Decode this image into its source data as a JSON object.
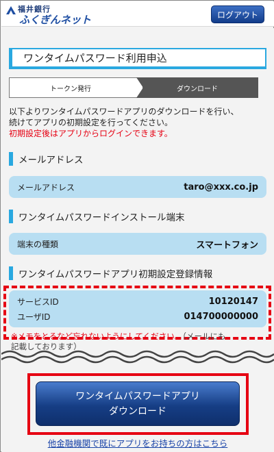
{
  "header": {
    "bank_name": "福井銀行",
    "service_name": "ふくぎんネット",
    "logout_label": "ログアウト"
  },
  "page_title": "ワンタイムパスワード利用申込",
  "steps": [
    {
      "label": "トークン発行",
      "active": false
    },
    {
      "label": "ダウンロード",
      "active": true
    }
  ],
  "intro": {
    "line1": "以下よりワンタイムパスワードアプリのダウンロードを行い、",
    "line2": "続けてアプリの初期設定を行ってください。",
    "warning": "初期設定後はアプリからログインできます。"
  },
  "sections": {
    "email": {
      "title": "メールアドレス",
      "label": "メールアドレス",
      "value": "taro@xxx.co.jp"
    },
    "device": {
      "title": "ワンタイムパスワードインストール端末",
      "label": "端末の種類",
      "value": "スマートフォン"
    },
    "registration": {
      "title": "ワンタイムパスワードアプリ初期設定登録情報",
      "service_id_label": "サービスID",
      "service_id_value": "10120147",
      "user_id_label": "ユーザID",
      "user_id_value": "014700000000"
    }
  },
  "note": {
    "red": "※メモをとるなど忘れないようにしてください。",
    "gray_line1": "（メールにも",
    "gray_line2": "記載しております）"
  },
  "download_button": {
    "line1": "ワンタイムパスワードアプリ",
    "line2": "ダウンロード"
  },
  "other_link": "他金融機関で既にアプリをお持ちの方はこちら",
  "colors": {
    "accent": "#29a8e0",
    "highlight_red": "#e60012",
    "button_blue": "#163e85",
    "box_blue": "#b8def2"
  }
}
